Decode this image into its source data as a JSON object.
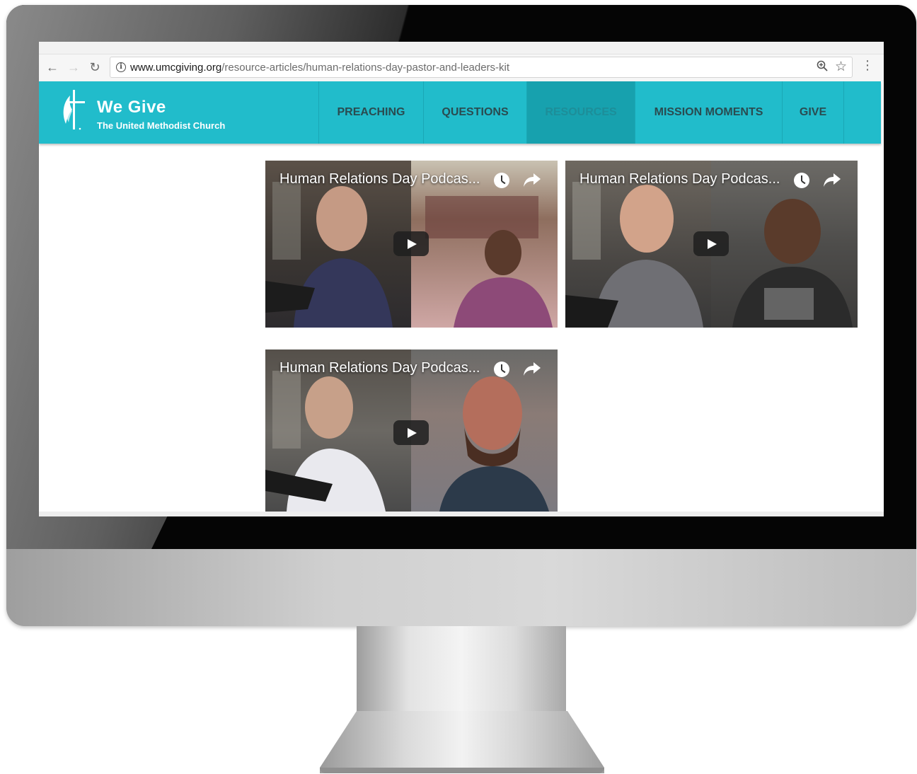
{
  "browser": {
    "url_host": "www.umcgiving.org",
    "url_path": "/resource-articles/human-relations-day-pastor-and-leaders-kit"
  },
  "site": {
    "logo_title": "We Give",
    "logo_subtitle": "The United Methodist Church",
    "brand_color": "#21bccb",
    "nav": [
      {
        "label": "PREACHING",
        "active": false
      },
      {
        "label": "QUESTIONS",
        "active": false
      },
      {
        "label": "RESOURCES",
        "active": true
      },
      {
        "label": "MISSION MOMENTS",
        "active": false
      },
      {
        "label": "GIVE",
        "active": false
      }
    ]
  },
  "videos": [
    {
      "title": "Human Relations Day Podcas..."
    },
    {
      "title": "Human Relations Day Podcas..."
    },
    {
      "title": "Human Relations Day Podcas..."
    }
  ],
  "icons": {
    "back": "arrow-left-icon",
    "forward": "arrow-right-icon",
    "reload": "reload-icon",
    "info": "info-icon",
    "zoom": "zoom-icon",
    "bookmark": "star-icon",
    "menu": "kebab-menu-icon",
    "watch_later": "clock-icon",
    "share": "share-icon",
    "play": "play-icon"
  }
}
